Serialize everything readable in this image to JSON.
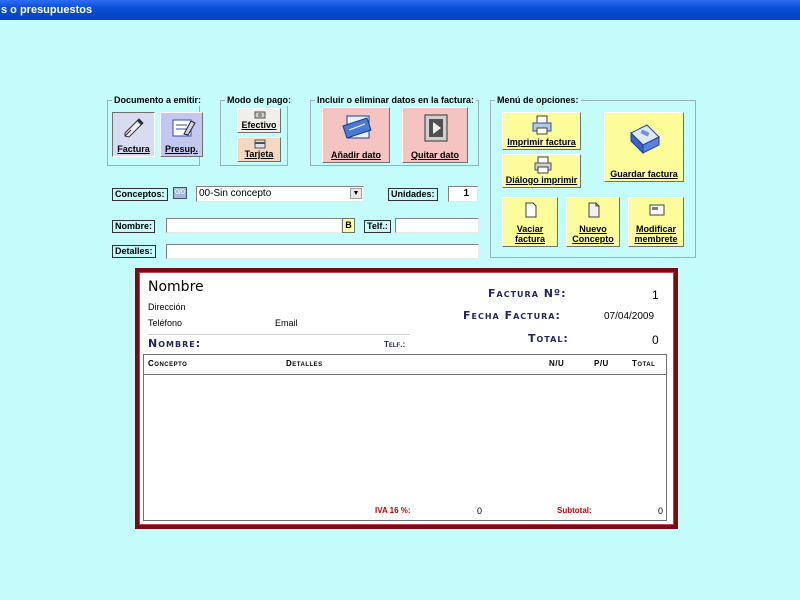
{
  "window": {
    "title": "s o presupuestos"
  },
  "document_group": {
    "title": "Documento a emitir:",
    "factura_label": "Factura",
    "presup_label": "Presup."
  },
  "payment_group": {
    "title": "Modo de pago:",
    "efectivo_label": "Efectivo",
    "tarjeta_label": "Tarjeta"
  },
  "data_group": {
    "title": "Incluir o eliminar datos en la factura:",
    "add_label": "Añadir dato",
    "remove_label": "Quitar dato"
  },
  "menu_group": {
    "title": "Menú de opciones:",
    "print_label": "Imprimir factura",
    "print_dialog_label": "Diálogo imprimir",
    "save_label": "Guardar factura",
    "empty_label_1": "Vaciar",
    "empty_label_2": "factura",
    "new_concept_label_1": "Nuevo",
    "new_concept_label_2": "Concepto",
    "letterhead_label_1": "Modificar",
    "letterhead_label_2": "membrete"
  },
  "form": {
    "conceptos_label": "Conceptos:",
    "concept_id_badge": "0/0",
    "concept_value": "00-Sin concepto",
    "unidades_label": "Unidades:",
    "unidades_value": "1",
    "nombre_label": "Nombre:",
    "nombre_value": "",
    "search_button": "B",
    "telf_label": "Telf.:",
    "telf_value": "",
    "detalles_label": "Detalles:",
    "detalles_value": ""
  },
  "invoice": {
    "company_name": "Nombre",
    "address": "Dirección",
    "phone": "Teléfono",
    "email": "Email",
    "invoice_no_label": "Factura Nº:",
    "invoice_no_value": "1",
    "date_label": "Fecha Factura:",
    "date_value": "07/04/2009",
    "client_name_label": "Nombre:",
    "client_phone_label": "Telf.:",
    "total_label": "Total:",
    "total_value": "0",
    "columns": [
      "Concepto",
      "Detalles",
      "N/U",
      "P/U",
      "Total"
    ],
    "iva_label": "IVA 16 %:",
    "iva_value": "0",
    "subtotal_label": "Subtotal:",
    "subtotal_value": "0"
  },
  "colors": {
    "background": "#c4fcfc",
    "invoice_border": "#7a0a14",
    "button_pink": "#f6c3c3",
    "button_yellow": "#fcfc9a",
    "label_red": "#c00000",
    "heading_navy": "#252560"
  }
}
